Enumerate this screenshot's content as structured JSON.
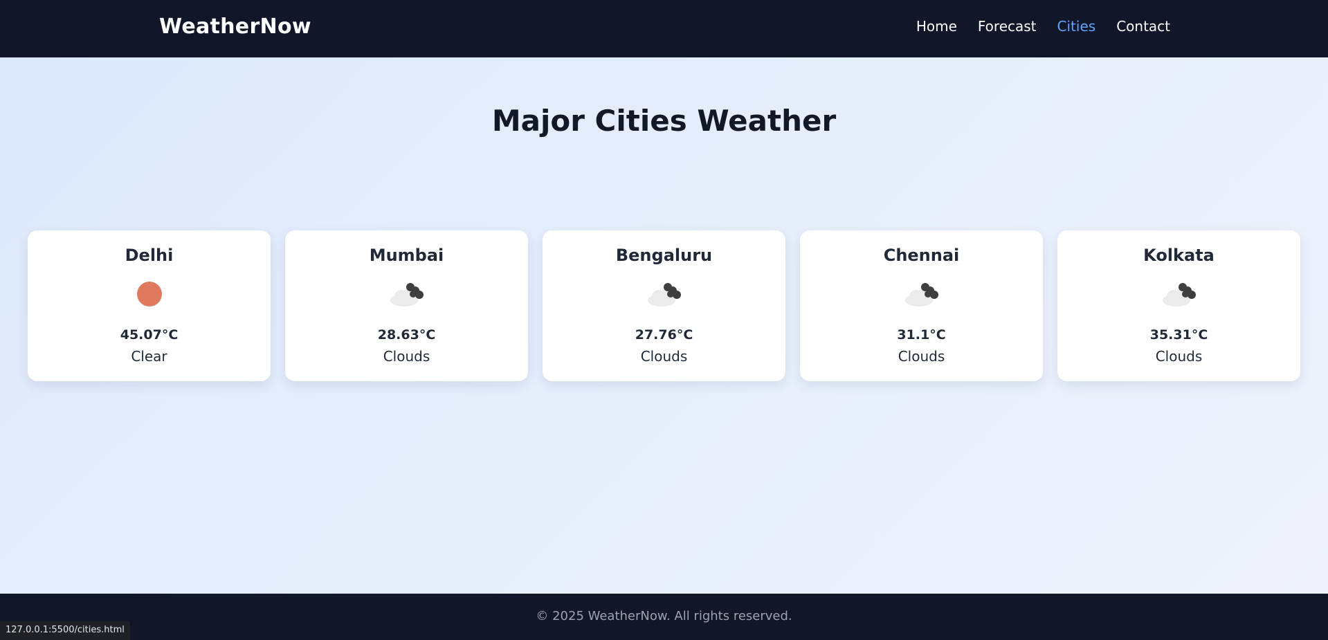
{
  "header": {
    "logo": "WeatherNow",
    "nav": [
      "Home",
      "Forecast",
      "Cities",
      "Contact"
    ],
    "active_nav": "Cities",
    "active_color": "#60a5fa"
  },
  "main": {
    "title": "Major Cities Weather",
    "cities": [
      {
        "name": "Delhi",
        "temp": "45.07°C",
        "desc": "Clear",
        "icon": "sun-icon"
      },
      {
        "name": "Mumbai",
        "temp": "28.63°C",
        "desc": "Clouds",
        "icon": "clouds-icon"
      },
      {
        "name": "Bengaluru",
        "temp": "27.76°C",
        "desc": "Clouds",
        "icon": "clouds-icon"
      },
      {
        "name": "Chennai",
        "temp": "31.1°C",
        "desc": "Clouds",
        "icon": "clouds-icon"
      },
      {
        "name": "Kolkata",
        "temp": "35.31°C",
        "desc": "Clouds",
        "icon": "clouds-icon"
      }
    ]
  },
  "footer": {
    "text": "© 2025 WeatherNow. All rights reserved."
  },
  "status_bar": {
    "url": "127.0.0.1:5500/cities.html"
  },
  "colors": {
    "navbar_bg": "#111729",
    "sun": "#e07a5f",
    "cloud_light": "#ebebeb",
    "cloud_dark": "#3f3f3f"
  }
}
